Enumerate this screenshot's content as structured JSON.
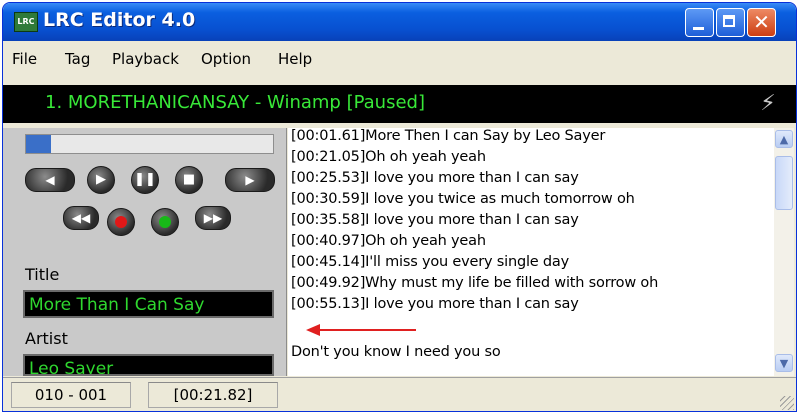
{
  "window": {
    "title": "LRC Editor 4.0",
    "app_icon_text": "LRC"
  },
  "menu": [
    "File",
    "Tag",
    "Playback",
    "Option",
    "Help"
  ],
  "now_playing": {
    "text": "1. MORETHANICANSAY - Winamp [Paused]"
  },
  "player": {
    "progress": 0.1
  },
  "fields": {
    "title_label": "Title",
    "title_value": "More Than I Can Say",
    "artist_label": "Artist",
    "artist_value": "Leo Sayer"
  },
  "lyrics": [
    "[00:01.61]More Then I can Say by Leo Sayer",
    "[00:21.05]Oh oh yeah yeah",
    "[00:25.53]I love you more than I can say",
    "[00:30.59]I love you twice as much tomorrow oh",
    "[00:35.58]I love you more than I can say",
    "[00:40.97]Oh oh yeah yeah",
    "[00:45.14]I'll miss you every single day",
    "[00:49.92]Why must my life be filled with sorrow oh",
    "[00:55.13]I love you more than I can say",
    "Don't you know I need you so"
  ],
  "status": {
    "index": "010 - 001",
    "time": "[00:21.82]"
  },
  "colors": {
    "display_text": "#38e838",
    "titlebar": "#0850d0",
    "arrow": "#e02020"
  }
}
